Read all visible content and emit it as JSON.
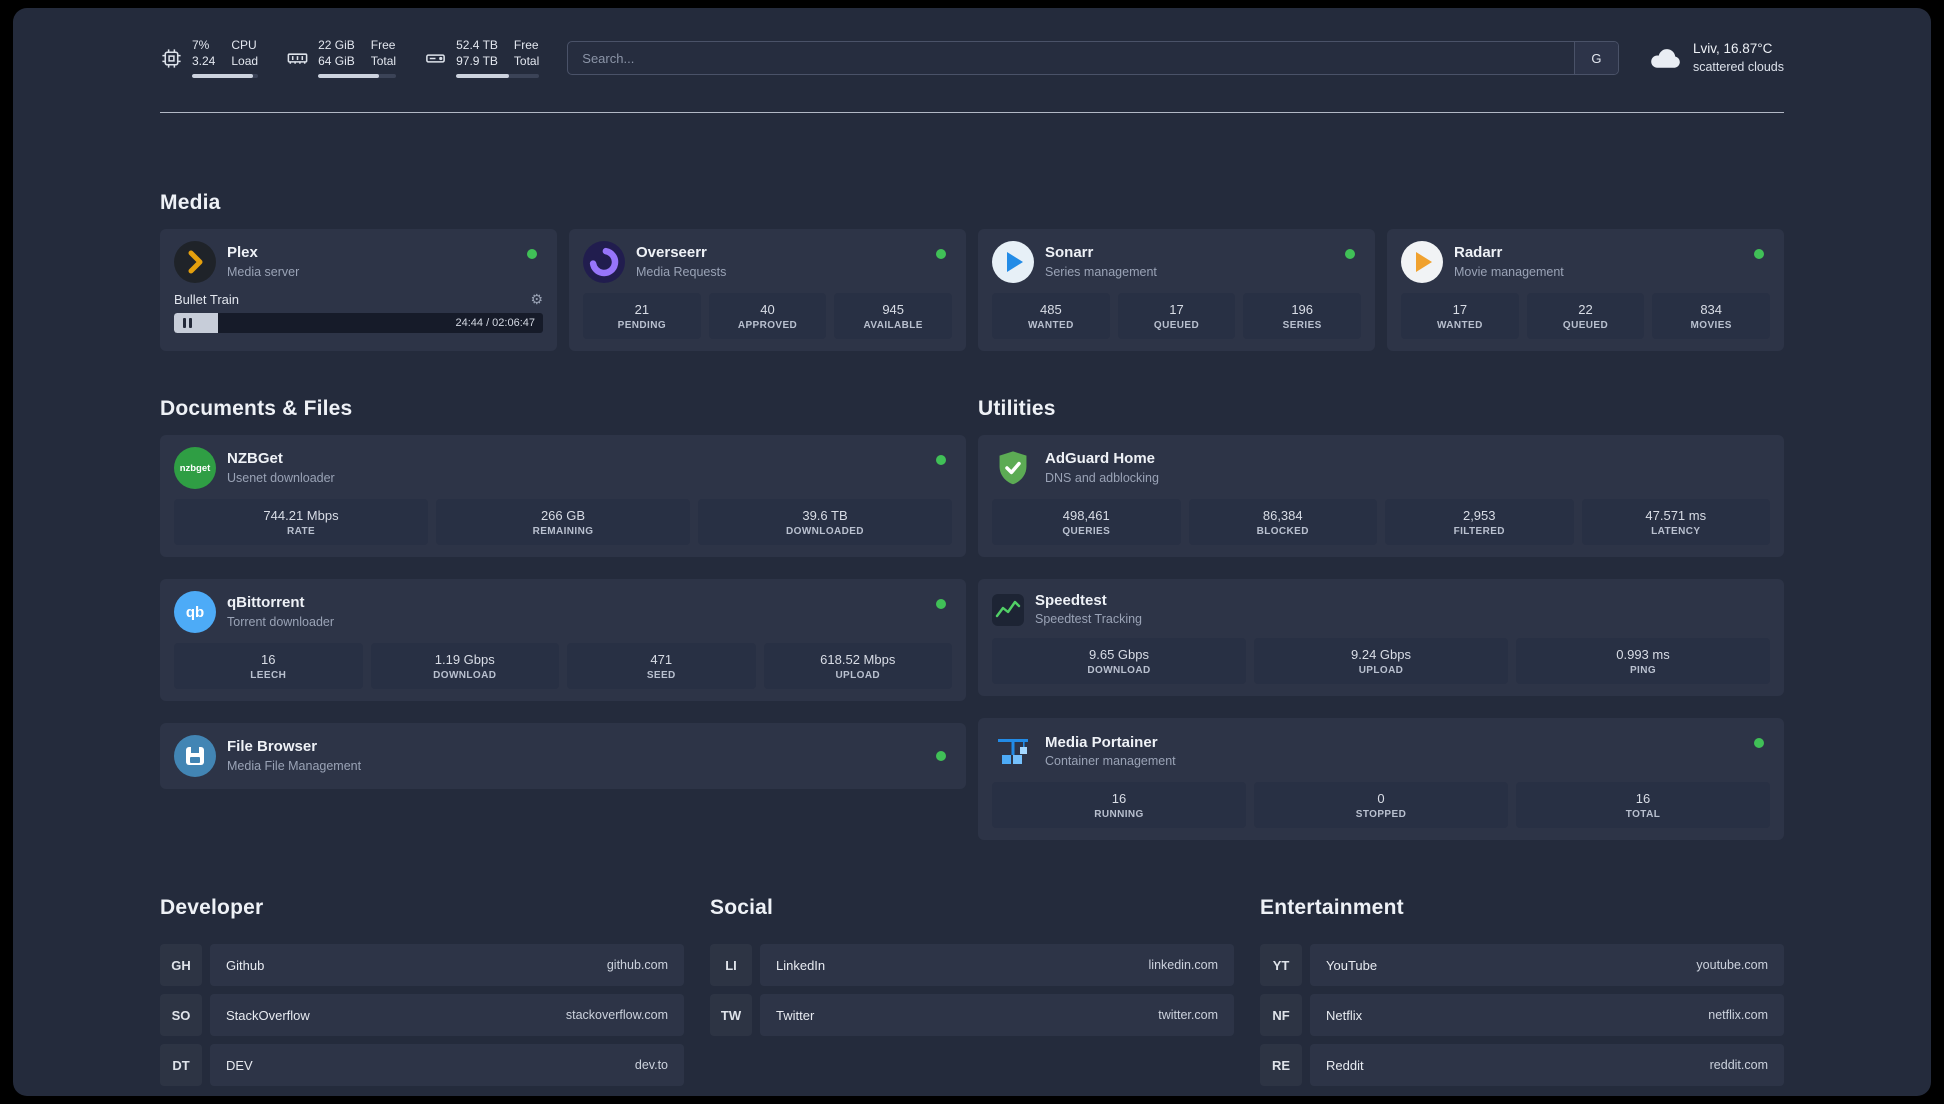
{
  "colors": {
    "status_online": "#40c057",
    "plex_accent": "#e5a00d",
    "sonarr_accent": "#228be6",
    "radarr_accent": "#f0a12e",
    "nzbget_accent": "#2f9e44",
    "qbittorrent_accent": "#4dabf7",
    "adguard_accent": "#5cab54",
    "speedtest_accent": "#51cf66",
    "portainer_accent": "#4dabf7"
  },
  "topbar": {
    "cpu": {
      "value_top": "7%",
      "value_bottom": "3.24",
      "label_top": "CPU",
      "label_bottom": "Load",
      "bar_percent": 92
    },
    "memory": {
      "value_top": "22 GiB",
      "value_bottom": "64 GiB",
      "label_top": "Free",
      "label_bottom": "Total",
      "bar_percent": 78
    },
    "disk": {
      "value_top": "52.4 TB",
      "value_bottom": "97.9 TB",
      "label_top": "Free",
      "label_bottom": "Total",
      "bar_percent": 63
    },
    "search": {
      "placeholder": "Search...",
      "engine_button": "G"
    },
    "weather": {
      "location": "Lviv, 16.87°C",
      "condition": "scattered clouds"
    }
  },
  "media": {
    "title": "Media",
    "plex": {
      "title": "Plex",
      "subtitle": "Media server",
      "now_playing": "Bullet Train",
      "time": "24:44 / 02:06:47",
      "progress_percent": 12
    },
    "overseerr": {
      "title": "Overseerr",
      "subtitle": "Media Requests",
      "stats": [
        {
          "value": "21",
          "label": "PENDING"
        },
        {
          "value": "40",
          "label": "APPROVED"
        },
        {
          "value": "945",
          "label": "AVAILABLE"
        }
      ]
    },
    "sonarr": {
      "title": "Sonarr",
      "subtitle": "Series management",
      "stats": [
        {
          "value": "485",
          "label": "WANTED"
        },
        {
          "value": "17",
          "label": "QUEUED"
        },
        {
          "value": "196",
          "label": "SERIES"
        }
      ]
    },
    "radarr": {
      "title": "Radarr",
      "subtitle": "Movie management",
      "stats": [
        {
          "value": "17",
          "label": "WANTED"
        },
        {
          "value": "22",
          "label": "QUEUED"
        },
        {
          "value": "834",
          "label": "MOVIES"
        }
      ]
    }
  },
  "documents": {
    "title": "Documents & Files",
    "nzbget": {
      "title": "NZBGet",
      "subtitle": "Usenet downloader",
      "logo_text": "nzbget",
      "stats": [
        {
          "value": "744.21 Mbps",
          "label": "RATE"
        },
        {
          "value": "266 GB",
          "label": "REMAINING"
        },
        {
          "value": "39.6 TB",
          "label": "DOWNLOADED"
        }
      ]
    },
    "qbittorrent": {
      "title": "qBittorrent",
      "subtitle": "Torrent downloader",
      "logo_text": "qb",
      "stats": [
        {
          "value": "16",
          "label": "LEECH"
        },
        {
          "value": "1.19 Gbps",
          "label": "DOWNLOAD"
        },
        {
          "value": "471",
          "label": "SEED"
        },
        {
          "value": "618.52 Mbps",
          "label": "UPLOAD"
        }
      ]
    },
    "filebrowser": {
      "title": "File Browser",
      "subtitle": "Media File Management"
    }
  },
  "utilities": {
    "title": "Utilities",
    "adguard": {
      "title": "AdGuard Home",
      "subtitle": "DNS and adblocking",
      "stats": [
        {
          "value": "498,461",
          "label": "QUERIES"
        },
        {
          "value": "86,384",
          "label": "BLOCKED"
        },
        {
          "value": "2,953",
          "label": "FILTERED"
        },
        {
          "value": "47.571 ms",
          "label": "LATENCY"
        }
      ]
    },
    "speedtest": {
      "title": "Speedtest",
      "subtitle": "Speedtest Tracking",
      "stats": [
        {
          "value": "9.65 Gbps",
          "label": "DOWNLOAD"
        },
        {
          "value": "9.24 Gbps",
          "label": "UPLOAD"
        },
        {
          "value": "0.993 ms",
          "label": "PING"
        }
      ]
    },
    "portainer": {
      "title": "Media Portainer",
      "subtitle": "Container management",
      "stats": [
        {
          "value": "16",
          "label": "RUNNING"
        },
        {
          "value": "0",
          "label": "STOPPED"
        },
        {
          "value": "16",
          "label": "TOTAL"
        }
      ]
    }
  },
  "bookmarks": {
    "developer": {
      "title": "Developer",
      "items": [
        {
          "abbr": "GH",
          "name": "Github",
          "url": "github.com"
        },
        {
          "abbr": "SO",
          "name": "StackOverflow",
          "url": "stackoverflow.com"
        },
        {
          "abbr": "DT",
          "name": "DEV",
          "url": "dev.to"
        }
      ]
    },
    "social": {
      "title": "Social",
      "items": [
        {
          "abbr": "LI",
          "name": "LinkedIn",
          "url": "linkedin.com"
        },
        {
          "abbr": "TW",
          "name": "Twitter",
          "url": "twitter.com"
        }
      ]
    },
    "entertainment": {
      "title": "Entertainment",
      "items": [
        {
          "abbr": "YT",
          "name": "YouTube",
          "url": "youtube.com"
        },
        {
          "abbr": "NF",
          "name": "Netflix",
          "url": "netflix.com"
        },
        {
          "abbr": "RE",
          "name": "Reddit",
          "url": "reddit.com"
        }
      ]
    }
  }
}
